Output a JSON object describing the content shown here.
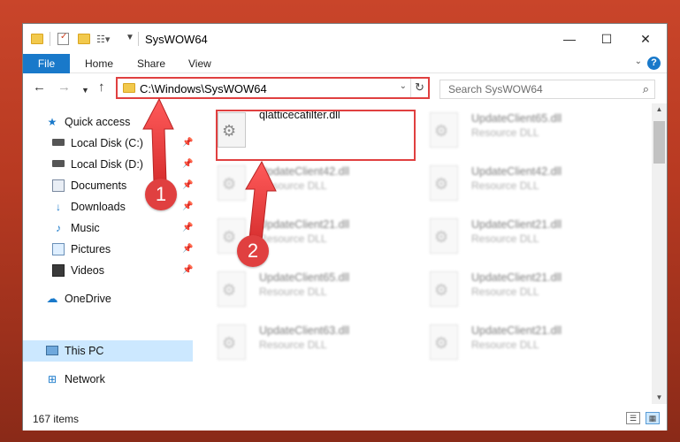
{
  "window": {
    "title": "SysWOW64",
    "controls": {
      "minimize": "—",
      "maximize": "☐",
      "close": "✕"
    }
  },
  "ribbon": {
    "tabs": [
      "File",
      "Home",
      "Share",
      "View"
    ],
    "help": "?"
  },
  "address_bar": {
    "path": "C:\\Windows\\SysWOW64"
  },
  "search": {
    "placeholder": "Search SysWOW64"
  },
  "nav_pane": {
    "quick_access": "Quick access",
    "items": [
      {
        "label": "Local Disk (C:)",
        "icon": "drive-icon"
      },
      {
        "label": "Local Disk (D:)",
        "icon": "drive-icon"
      },
      {
        "label": "Documents",
        "icon": "documents-icon"
      },
      {
        "label": "Downloads",
        "icon": "downloads-icon"
      },
      {
        "label": "Music",
        "icon": "music-icon"
      },
      {
        "label": "Pictures",
        "icon": "pictures-icon"
      },
      {
        "label": "Videos",
        "icon": "videos-icon"
      }
    ],
    "onedrive": "OneDrive",
    "this_pc": "This PC",
    "network": "Network"
  },
  "files": [
    {
      "name": "qlatticecafilter.dll",
      "type": "",
      "blurred": false
    },
    {
      "name": "UpdateClient65.dll",
      "type": "Resource DLL",
      "blurred": true
    },
    {
      "name": "UpdateClient42.dll",
      "type": "Resource DLL",
      "blurred": true
    },
    {
      "name": "UpdateClient42.dll",
      "type": "Resource DLL",
      "blurred": true
    },
    {
      "name": "UpdateClient21.dll",
      "type": "Resource DLL",
      "blurred": true
    },
    {
      "name": "UpdateClient21.dll",
      "type": "Resource DLL",
      "blurred": true
    },
    {
      "name": "UpdateClient65.dll",
      "type": "Resource DLL",
      "blurred": true
    },
    {
      "name": "UpdateClient21.dll",
      "type": "Resource DLL",
      "blurred": true
    },
    {
      "name": "UpdateClient63.dll",
      "type": "Resource DLL",
      "blurred": true
    },
    {
      "name": "UpdateClient21.dll",
      "type": "Resource DLL",
      "blurred": true
    }
  ],
  "status": {
    "items_count": "167 items"
  },
  "callouts": [
    "1",
    "2"
  ],
  "colors": {
    "accent": "#1979ca",
    "highlight_red": "#e04040",
    "selection": "#cce8ff"
  }
}
